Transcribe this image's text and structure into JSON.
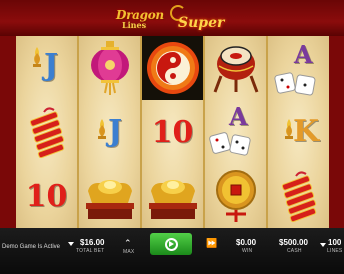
{
  "game": {
    "title_part1": "Dragon",
    "title_part2": "Lines",
    "title_part3": "Super"
  },
  "reels": [
    [
      "fleur-de-lis-J",
      "firecrackers",
      "ten"
    ],
    [
      "lantern",
      "fleur-de-lis-J",
      "gold-ingot"
    ],
    [
      "dragon-medallion",
      "ten",
      "gold-ingot"
    ],
    [
      "drum",
      "dice-A",
      "gold-coin"
    ],
    [
      "dice-A",
      "fleur-de-lis-K",
      "firecrackers"
    ]
  ],
  "symbols": {
    "J": "J",
    "K": "K",
    "ten": "10",
    "A": "A"
  },
  "footer": {
    "status": "Demo Game Is Active",
    "total_bet_value": "$16.00",
    "total_bet_label": "TOTAL BET",
    "win_value": "$0.00",
    "win_label": "WIN",
    "cash_value": "$500.00",
    "cash_label": "CASH",
    "lines_value": "100",
    "lines_label": "LINES"
  },
  "colors": {
    "banner": "#8b0c0c",
    "spin_button": "#2fae2c",
    "reel_background": "#ebd49c"
  }
}
